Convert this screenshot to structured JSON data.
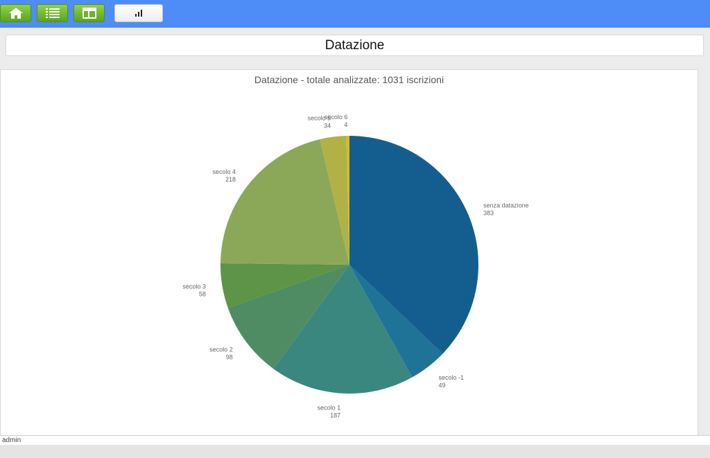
{
  "toolbar": {
    "buttons": [
      {
        "name": "home-button",
        "icon": "home-icon"
      },
      {
        "name": "list-button",
        "icon": "list-icon"
      },
      {
        "name": "table-button",
        "icon": "table-layout-icon"
      },
      {
        "name": "chart-button",
        "icon": "bar-chart-icon"
      }
    ],
    "accent_color": "#4e8df7"
  },
  "page": {
    "title": "Datazione"
  },
  "footer": {
    "user": "admin"
  },
  "chart_data": {
    "type": "pie",
    "title": "Datazione - totale analizzate: 1031 iscrizioni",
    "slices": [
      {
        "label": "senza datazione",
        "value": 383,
        "color": "#145e8f"
      },
      {
        "label": "secolo -1",
        "value": 49,
        "color": "#1f7397"
      },
      {
        "label": "secolo 1",
        "value": 187,
        "color": "#3a877f"
      },
      {
        "label": "secolo 2",
        "value": 98,
        "color": "#4f8c64"
      },
      {
        "label": "secolo 3",
        "value": 58,
        "color": "#5d9447"
      },
      {
        "label": "secolo 4",
        "value": 218,
        "color": "#8ba858"
      },
      {
        "label": "secolo 5",
        "value": 34,
        "color": "#b1b145"
      },
      {
        "label": "secolo 6",
        "value": 4,
        "color": "#d4bd28"
      }
    ]
  }
}
